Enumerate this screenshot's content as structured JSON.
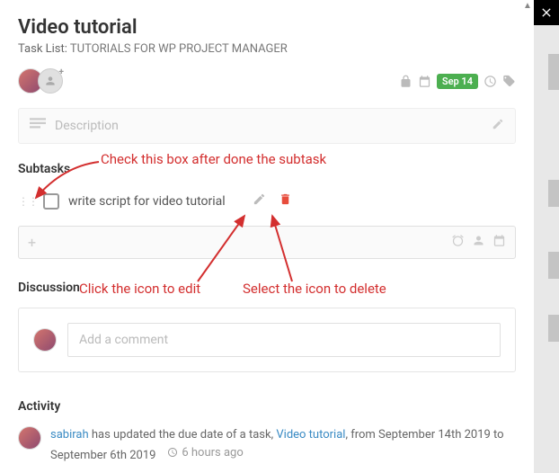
{
  "title": "Video tutorial",
  "tasklist_label": "Task List:",
  "tasklist_name": "TUTORIALS FOR WP PROJECT MANAGER",
  "due_date": "Sep 14",
  "description_placeholder": "Description",
  "sections": {
    "subtasks": "Subtasks",
    "discussion": "Discussion",
    "activity": "Activity"
  },
  "subtasks": [
    {
      "text": "write script for video tutorial",
      "done": false
    }
  ],
  "comment_placeholder": "Add a comment",
  "activity": {
    "user": "sabirah",
    "text1": " has updated the due date of a task, ",
    "task": "Video tutorial",
    "text2": ", from September 14th 2019 to September 6th 2019",
    "time": "6 hours ago"
  },
  "annotations": {
    "check": "Check this box after done the subtask",
    "edit": "Click the icon to edit",
    "delete": "Select the icon to delete"
  }
}
